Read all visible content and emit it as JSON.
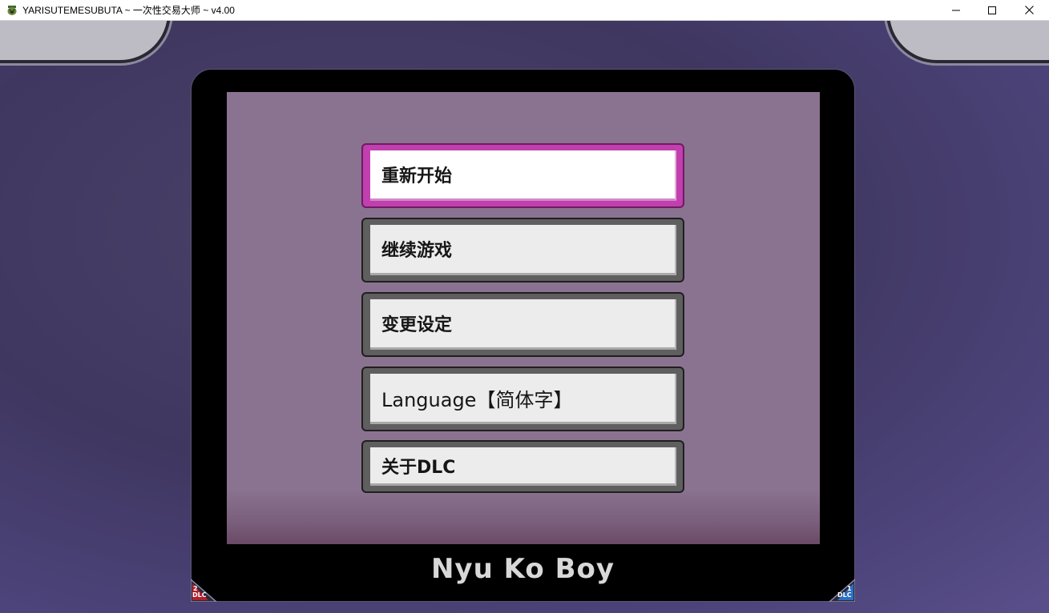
{
  "window": {
    "title": "YARISUTEMESUBUTA ~ 一次性交易大师 ~ v4.00",
    "icon": "pig-face-icon"
  },
  "window_controls": {
    "minimize_icon": "minimize-icon",
    "maximize_icon": "maximize-icon",
    "close_icon": "close-icon"
  },
  "menu": {
    "items": [
      {
        "label": "重新开始",
        "selected": true
      },
      {
        "label": "继续游戏",
        "selected": false
      },
      {
        "label": "变更设定",
        "selected": false
      },
      {
        "label": "Language【简体字】",
        "selected": false
      },
      {
        "label": "关于DLC",
        "selected": false
      }
    ]
  },
  "device": {
    "brand": "Nyu Ko Boy"
  },
  "dlc_corners": {
    "left": {
      "number": "2",
      "label": "DLC"
    },
    "right": {
      "number": "1",
      "label": "DLC"
    }
  },
  "colors": {
    "selected_border": "#c13fae",
    "button_border": "#5f5f5f",
    "screen": "#8a7390",
    "background": "#3f3760",
    "dlc_left": "#b0202c",
    "dlc_right": "#2b6fc4"
  }
}
